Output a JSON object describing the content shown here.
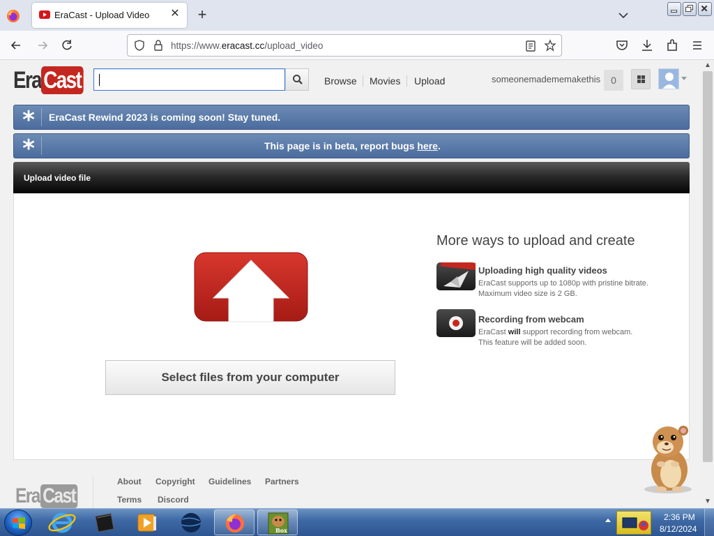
{
  "browser": {
    "tab_title": "EraCast - Upload Video",
    "url_prefix": "https://www.",
    "url_host": "eracast.cc",
    "url_path": "/upload_video"
  },
  "site": {
    "logo_era": "Era",
    "logo_cast": "Cast",
    "search_placeholder": "",
    "nav": {
      "browse": "Browse",
      "movies": "Movies",
      "upload": "Upload"
    },
    "username": "someonemadememakethis",
    "notification_count": "0"
  },
  "banners": {
    "rewind": "EraCast Rewind 2023 is coming soon! Stay tuned.",
    "beta_prefix": "This page is in beta, report bugs ",
    "beta_link": "here",
    "beta_suffix": "."
  },
  "upload": {
    "section_title": "Upload video file",
    "select_button": "Select files from your computer",
    "more_title": "More ways to upload and create",
    "options": [
      {
        "title": "Uploading high quality videos",
        "desc_line1": "EraCast supports up to 1080p with pristine bitrate.",
        "desc_line2": "Maximum video size is 2 GB."
      },
      {
        "title": "Recording from webcam",
        "desc_pre": "EraCast ",
        "desc_bold": "will",
        "desc_post": " support recording from webcam.",
        "desc_line2": "This feature will be added soon."
      }
    ]
  },
  "footer": {
    "logo_era": "Era",
    "logo_cast": "Cast",
    "links": {
      "about": "About",
      "copyright": "Copyright",
      "guidelines": "Guidelines",
      "partners": "Partners",
      "terms": "Terms",
      "discord": "Discord"
    }
  },
  "taskbar": {
    "time": "2:36 PM",
    "date": "8/12/2024",
    "box_label": "Box"
  },
  "colors": {
    "brand_red": "#c4271f",
    "banner_blue": "#4b6c9d",
    "taskbar_blue": "#3f6aa6"
  }
}
